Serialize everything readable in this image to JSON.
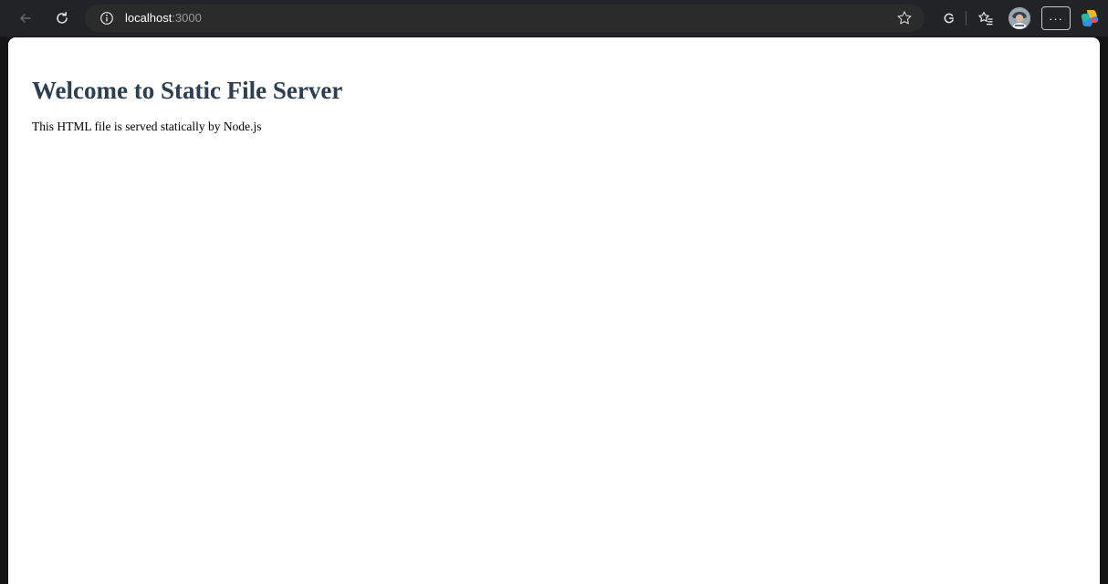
{
  "browser": {
    "address_bar": {
      "host": "localhost",
      "port": ":3000"
    },
    "icons": {
      "back": "back-arrow-icon",
      "refresh": "refresh-icon",
      "site_info": "info-icon",
      "favorite": "star-icon",
      "extensions": "extensions-icon",
      "favorites_hub": "favorites-list-icon",
      "profile": "profile-avatar",
      "more": "more-icon",
      "copilot": "copilot-icon"
    },
    "more_label": "···"
  },
  "page": {
    "heading": "Welcome to Static File Server",
    "text": "This HTML file is served statically by Node.js"
  },
  "colors": {
    "heading": "#2c3e50",
    "toolbar_bg": "#222326",
    "address_bg": "#2b2b2b"
  }
}
